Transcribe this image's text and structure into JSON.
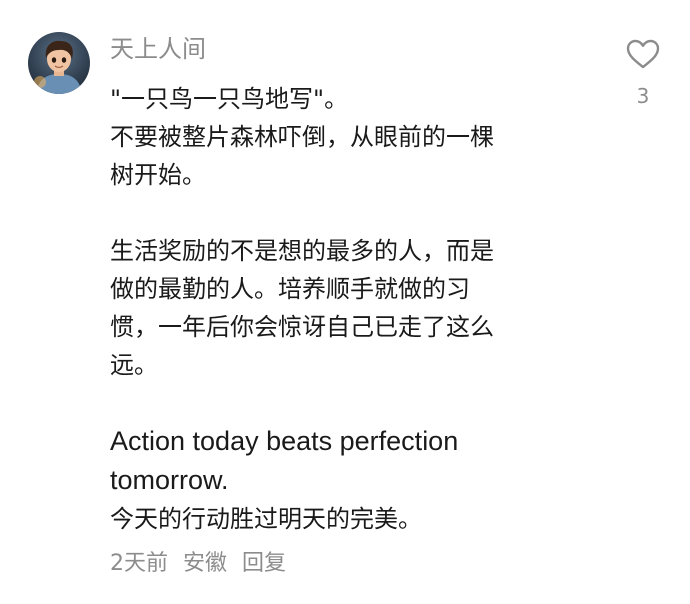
{
  "comment": {
    "username": "天上人间",
    "avatar_icon": "avatar-boy-illustration",
    "paragraphs": [
      "\"一只鸟一只鸟地写\"。\n不要被整片森林吓倒，从眼前的一棵\n树开始。",
      "生活奖励的不是想的最多的人，而是\n做的最勤的人。培养顺手就做的习\n惯，一年后你会惊讶自己已走了这么\n远。"
    ],
    "english_line": "Action today beats perfection\ntomorrow.",
    "chinese_line": "今天的行动胜过明天的完美。",
    "meta": {
      "time": "2天前",
      "location": "安徽",
      "reply_label": "回复"
    },
    "like": {
      "icon": "heart-outline-icon",
      "count": "3",
      "color": "#8c8c8c"
    }
  }
}
